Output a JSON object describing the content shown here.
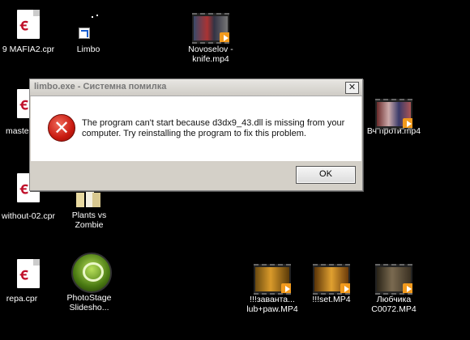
{
  "desktop": {
    "icons": [
      {
        "label": "9 MAFIA2.cpr"
      },
      {
        "label": "Limbo"
      },
      {
        "label": "Novoselov - knife.mp4"
      },
      {
        "label": "maste"
      },
      {
        "label": "Вч проти.mp4"
      },
      {
        "label": "without-02.cpr"
      },
      {
        "label": "Plants vs Zombie"
      },
      {
        "label": "repa.cpr"
      },
      {
        "label": "PhotoStage Slidesho..."
      },
      {
        "label": "!!!заванта... lub+paw.MP4"
      },
      {
        "label": "!!!set.MP4"
      },
      {
        "label": "Любчика C0072.MP4"
      }
    ]
  },
  "dialog": {
    "title": "limbo.exe - Системна помилка",
    "message": "The program can't start because d3dx9_43.dll is missing from your computer. Try reinstalling the program to fix this problem.",
    "ok_label": "OK",
    "close_glyph": "✕",
    "icon": "error-x-icon"
  }
}
